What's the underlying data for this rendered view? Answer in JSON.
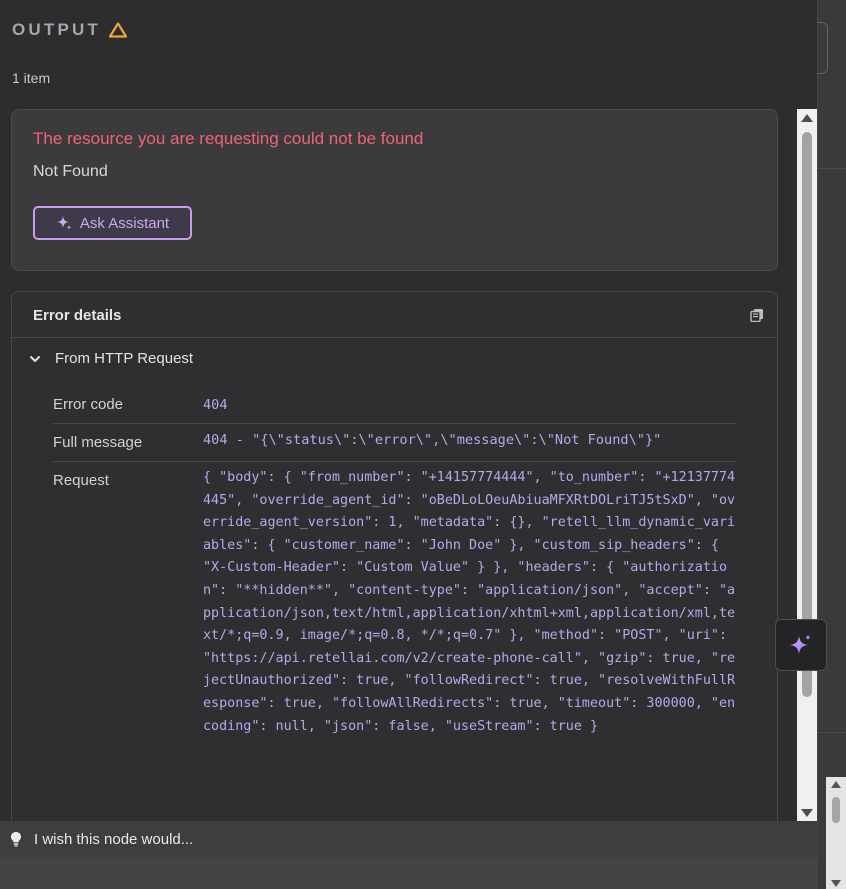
{
  "output": {
    "title": "OUTPUT",
    "item_count": "1 item"
  },
  "error": {
    "title": "The resource you are requesting could not be found",
    "subtitle": "Not Found",
    "ask_button": "Ask Assistant"
  },
  "details": {
    "title": "Error details",
    "section_label": "From HTTP Request",
    "rows": {
      "error_code": {
        "key": "Error code",
        "value": "404"
      },
      "full_message": {
        "key": "Full message",
        "value": "404 - \"{\\\"status\\\":\\\"error\\\",\\\"message\\\":\\\"Not Found\\\"}\""
      },
      "request": {
        "key": "Request",
        "value": "{ \"body\": { \"from_number\": \"+14157774444\", \"to_number\": \"+12137774445\", \"override_agent_id\": \"oBeDLoLOeuAbiuaMFXRtDOLriTJ5tSxD\", \"override_agent_version\": 1, \"metadata\": {}, \"retell_llm_dynamic_variables\": { \"customer_name\": \"John Doe\" }, \"custom_sip_headers\": { \"X-Custom-Header\": \"Custom Value\" } }, \"headers\": { \"authorization\": \"**hidden**\", \"content-type\": \"application/json\", \"accept\": \"application/json,text/html,application/xhtml+xml,application/xml,text/*;q=0.9, image/*;q=0.8, */*;q=0.7\" }, \"method\": \"POST\", \"uri\": \"https://api.retellai.com/v2/create-phone-call\", \"gzip\": true, \"rejectUnauthorized\": true, \"followRedirect\": true, \"resolveWithFullResponse\": true, \"followAllRedirects\": true, \"timeout\": 300000, \"encoding\": null, \"json\": false, \"useStream\": true }"
      }
    }
  },
  "footer": {
    "feedback_text": "I wish this node would..."
  },
  "icons": {
    "warning": "warning-triangle-icon",
    "sparkle": "sparkle-icon",
    "copy": "copy-icon",
    "chevron": "chevron-down-icon",
    "bulb": "lightbulb-icon"
  },
  "colors": {
    "error_text": "#f0627a",
    "accent_purple": "#c69cf0",
    "warning": "#f0a53a",
    "code_value": "#b6a8ec"
  }
}
